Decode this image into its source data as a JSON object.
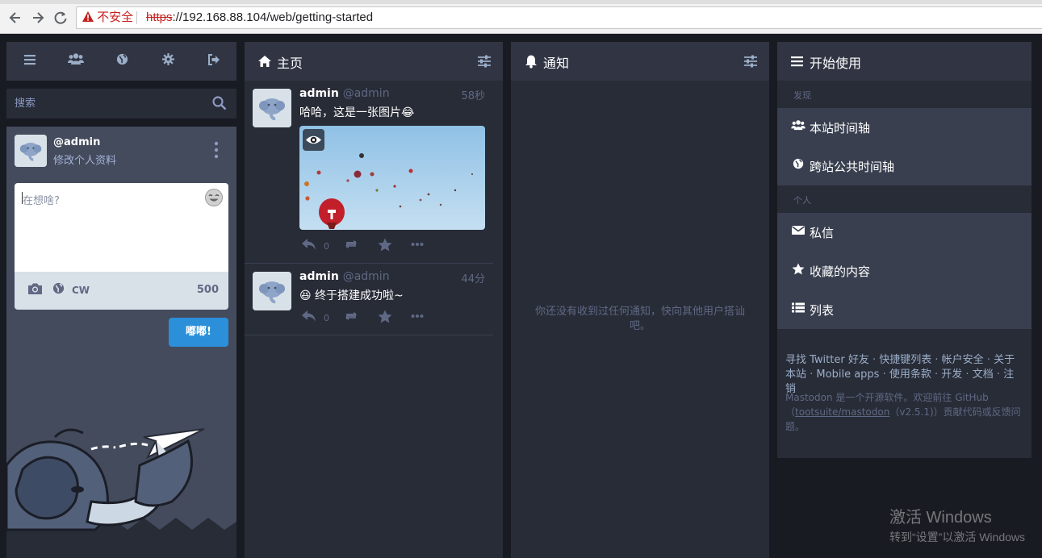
{
  "browser": {
    "security_label": "不安全",
    "url_scheme": "https",
    "url_rest": "://192.168.88.104/web/getting-started"
  },
  "compose": {
    "search_placeholder": "搜索",
    "account_handle": "@admin",
    "edit_profile": "修改个人资料",
    "placeholder": "在想啥?",
    "cw_label": "CW",
    "char_count": "500",
    "toot_label": "嘟嘟!"
  },
  "home": {
    "title": "主页",
    "statuses": [
      {
        "display_name": "admin",
        "username": "@admin",
        "time": "58秒",
        "text": "哈哈，这是一张图片😂",
        "reply_count": "0"
      },
      {
        "display_name": "admin",
        "username": "@admin",
        "time": "44分",
        "text": "😆 终于搭建成功啦~",
        "reply_count": "0"
      }
    ]
  },
  "notifications": {
    "title": "通知",
    "empty_message": "你还没有收到过任何通知，快向其他用户搭讪吧。"
  },
  "getting_started": {
    "title": "开始使用",
    "section_discover": "发现",
    "local_timeline": "本站时间轴",
    "federated_timeline": "跨站公共时间轴",
    "section_personal": "个人",
    "direct_messages": "私信",
    "favourites": "收藏的内容",
    "lists": "列表",
    "links": {
      "find_twitter": "寻找 Twitter 好友",
      "hotkeys": "快捷键列表",
      "security": "帐户安全",
      "about": "关于本站",
      "mobile_apps": "Mobile apps",
      "terms": "使用条款",
      "developers": "开发",
      "docs": "文档",
      "logout": "注销"
    },
    "info_prefix": "Mastodon 是一个开源软件。欢迎前往 GitHub（",
    "info_link": "tootsuite/mastodon",
    "info_suffix": "（v2.5.1)）贡献代码或反馈问题。"
  },
  "watermark": {
    "line1": "激活 Windows",
    "line2": "转到“设置”以激活 Windows"
  },
  "icons": {
    "menu": "hamburger-icon",
    "people": "users-icon",
    "globe": "globe-icon",
    "gear": "gear-icon",
    "logout": "sign-out-icon"
  },
  "colors": {
    "background": "#191b22",
    "column": "#282c37",
    "header": "#313543",
    "accent": "#2b90d9",
    "muted": "#606984"
  }
}
